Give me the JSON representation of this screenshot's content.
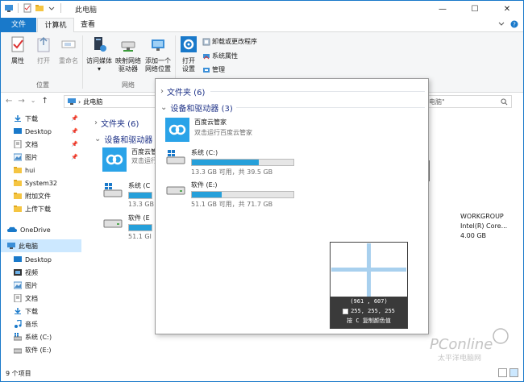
{
  "window": {
    "title": "此电脑",
    "controls": {
      "minimize": "—",
      "maximize": "☐",
      "close": "✕"
    }
  },
  "ribbon_tabs": {
    "file": "文件",
    "computer": "计算机",
    "view": "查看"
  },
  "ribbon": {
    "location_group": {
      "label": "位置",
      "properties": "属性",
      "open": "打开",
      "rename": "重命名"
    },
    "network_group": {
      "label": "网络",
      "access_media": "访问媒体",
      "map_drive_line1": "映射网络",
      "map_drive_line2": "驱动器",
      "add_location_line1": "添加一个",
      "add_location_line2": "网络位置"
    },
    "system_group": {
      "open_settings_line1": "打开",
      "open_settings_line2": "设置",
      "uninstall": "卸载或更改程序",
      "system_properties": "系统属性",
      "manage": "管理"
    }
  },
  "address": {
    "path": "此电脑",
    "search_placeholder": "电脑\""
  },
  "nav": {
    "quick_access": [
      {
        "label": "下载",
        "pinned": true
      },
      {
        "label": "Desktop",
        "pinned": true
      },
      {
        "label": "文档",
        "pinned": true
      },
      {
        "label": "图片",
        "pinned": true
      },
      {
        "label": "hui",
        "pinned": false
      },
      {
        "label": "System32",
        "pinned": false
      },
      {
        "label": "附加文件",
        "pinned": false
      },
      {
        "label": "上传下载",
        "pinned": false
      }
    ],
    "onedrive": "OneDrive",
    "this_pc": "此电脑",
    "pc_items": [
      "Desktop",
      "视频",
      "图片",
      "文档",
      "下载",
      "音乐",
      "系统 (C:)",
      "软件 (E:)"
    ]
  },
  "content": {
    "folders_header": "文件夹 (6)",
    "devices_header": "设备和驱动器 (3)",
    "baidu_partial": "百度云管",
    "baidu_sub_partial": "双击运行",
    "drive_c_partial": "系统 (C",
    "drive_c_size_partial": "13.3 GB",
    "drive_e_partial": "软件 (E",
    "drive_e_size_partial": "51.1 GI"
  },
  "details": {
    "workgroup": "WORKGROUP",
    "cpu": "Intel(R) Core...",
    "ram": "4.00 GB"
  },
  "popup": {
    "folders_header": "文件夹 (6)",
    "devices_header": "设备和驱动器 (3)",
    "baidu": {
      "name": "百度云管家",
      "subtitle": "双击运行百度云管家"
    },
    "drives": [
      {
        "name": "系统 (C:)",
        "used_fraction": 0.66,
        "size_text": "13.3 GB 可用，共 39.5 GB"
      },
      {
        "name": "软件 (E:)",
        "used_fraction": 0.29,
        "size_text": "51.1 GB 可用，共 71.7 GB"
      }
    ]
  },
  "magnifier": {
    "coords": "(961 , 607)",
    "rgb": "255, 255, 255",
    "hint": "按 C 复制颜色值"
  },
  "statusbar": {
    "items": "9 个项目"
  },
  "watermark": {
    "brand": "PConline",
    "sub": "太平洋电脑网"
  },
  "colors": {
    "accent": "#1979ca",
    "bar_fill": "#26a0da",
    "selection": "#cce8ff",
    "header_text": "#1e3287"
  }
}
